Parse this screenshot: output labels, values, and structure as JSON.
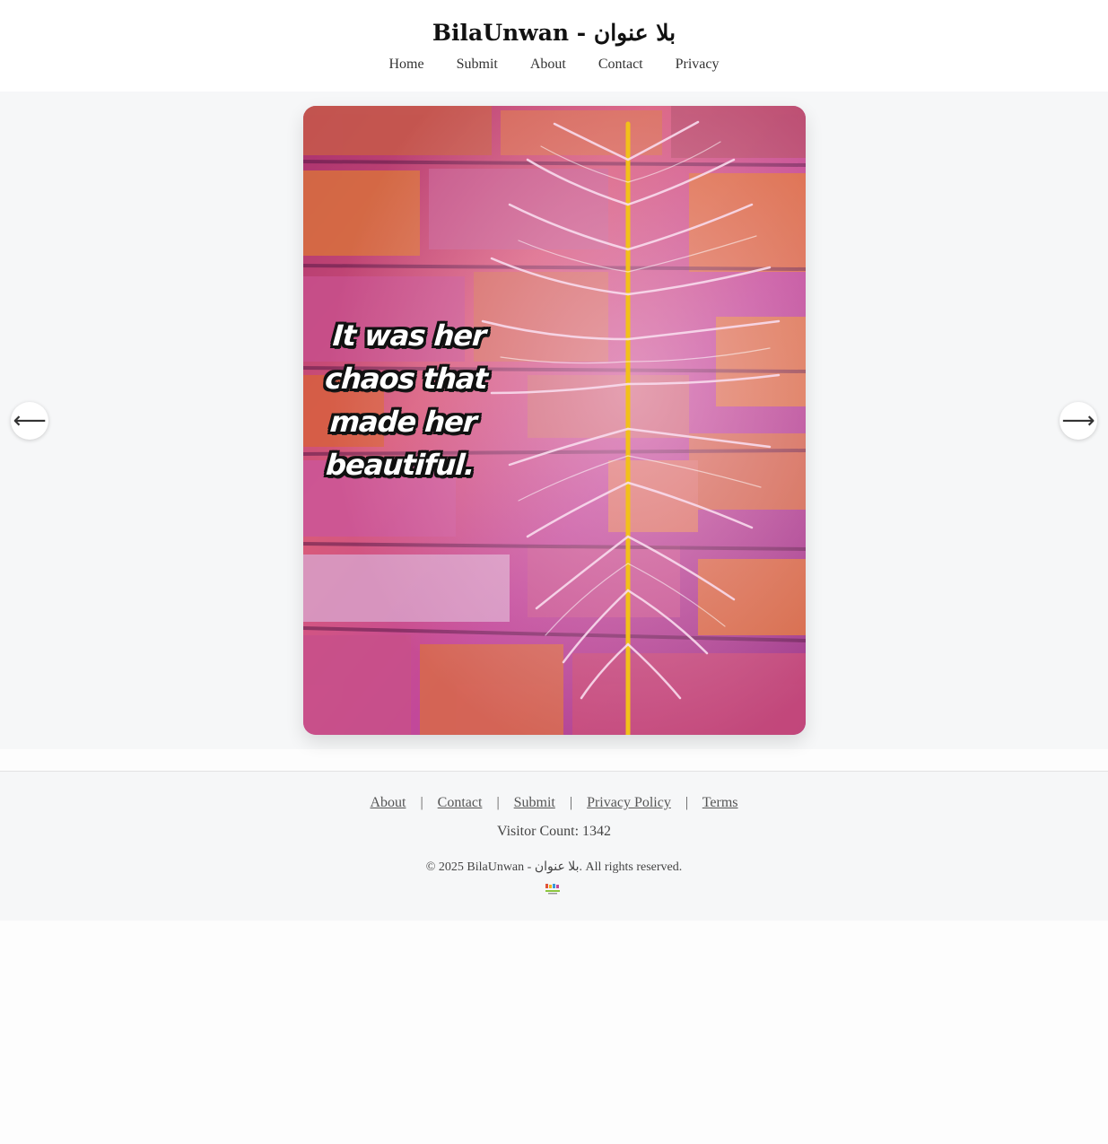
{
  "header": {
    "title": "BilaUnwan - بلا عنوان",
    "nav": [
      "Home",
      "Submit",
      "About",
      "Contact",
      "Privacy"
    ]
  },
  "carousel": {
    "quote": "It was her chaos that made her beautiful.",
    "prev_icon": "arrow-left-icon",
    "next_icon": "arrow-right-icon",
    "prev_label": "⟵",
    "next_label": "⟶"
  },
  "footer": {
    "links": [
      "About",
      "Contact",
      "Submit",
      "Privacy Policy",
      "Terms"
    ],
    "separator": "|",
    "visitor_count": "Visitor Count: 1342",
    "copyright": "© 2025 BilaUnwan - بلا عنوان. All rights reserved."
  },
  "colors": {
    "hero_bg": "#f6f7f8",
    "footer_bg": "#f6f7f8",
    "poster_magenta": "#c2489a",
    "poster_orange": "#e0713a",
    "grass_yellow": "#f2c01a"
  }
}
